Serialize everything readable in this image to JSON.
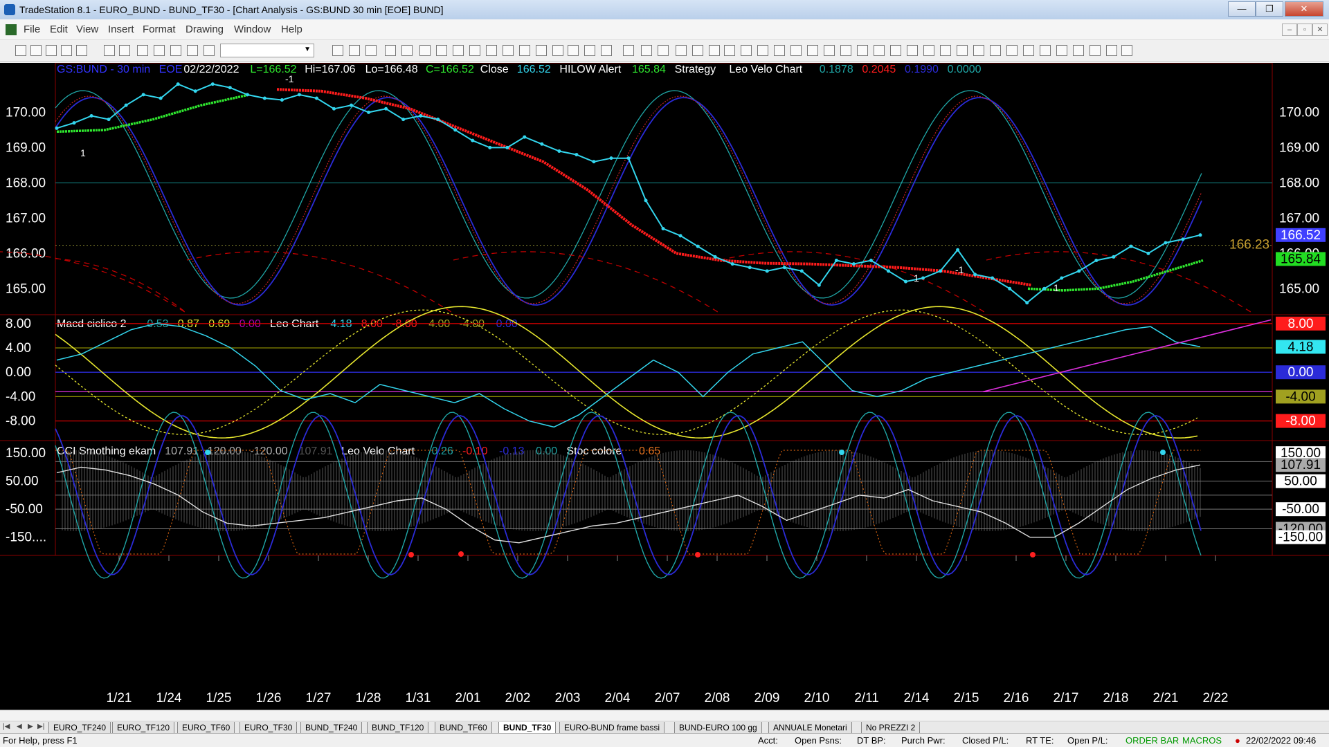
{
  "window": {
    "title": "TradeStation 8.1 - EURO_BUND - BUND_TF30 - [Chart Analysis - GS:BUND  30 min  [EOE] BUND]",
    "minimize": "—",
    "restore": "❐",
    "close": "✕"
  },
  "menu": {
    "items": [
      "File",
      "Edit",
      "View",
      "Insert",
      "Format",
      "Drawing",
      "Window",
      "Help"
    ],
    "mdi": [
      "–",
      "▫",
      "✕"
    ]
  },
  "colors": {
    "price": "#33d6ee",
    "red_avg": "#ff1c1c",
    "green_avg": "#2fe82f",
    "blue_osc": "#2b2bd8",
    "teal_osc": "#1fa6a6",
    "yellow": "#e6e62e",
    "magenta": "#e030e0",
    "grid_red": "#cc0000",
    "grid_teal": "#0f6f6f"
  },
  "header": {
    "price": [
      {
        "t": "GS:BUND - 30 min",
        "c": "#3333ff"
      },
      {
        "t": "EOE",
        "c": "#3333ff"
      },
      {
        "t": "02/22/2022",
        "c": "#ffffff"
      },
      {
        "t": "L=166.52",
        "c": "#2fe82f"
      },
      {
        "t": "Hi=167.06",
        "c": "#ffffff"
      },
      {
        "t": "Lo=166.48",
        "c": "#ffffff"
      },
      {
        "t": "C=166.52",
        "c": "#2fe82f"
      },
      {
        "t": "Close",
        "c": "#ffffff"
      },
      {
        "t": "166.52",
        "c": "#33d6ee"
      },
      {
        "t": "HILOW Alert",
        "c": "#ffffff"
      },
      {
        "t": "165.84",
        "c": "#2fe82f"
      },
      {
        "t": "Strategy",
        "c": "#ffffff"
      },
      {
        "t": "Leo Velo Chart",
        "c": "#ffffff"
      },
      {
        "t": "0.1878",
        "c": "#1fa6a6"
      },
      {
        "t": "0.2045",
        "c": "#ff1c1c"
      },
      {
        "t": "0.1990",
        "c": "#2b2bd8"
      },
      {
        "t": "0.0000",
        "c": "#1fa6a6"
      }
    ],
    "macd": [
      {
        "t": "Macd ciclico 2",
        "c": "#ffffff"
      },
      {
        "t": "0.53",
        "c": "#1fa6a6"
      },
      {
        "t": "0.87",
        "c": "#e6e62e"
      },
      {
        "t": "0.69",
        "c": "#e6e62e"
      },
      {
        "t": "0.00",
        "c": "#b000b0"
      },
      {
        "t": "Leo Chart",
        "c": "#ffffff"
      },
      {
        "t": "4.18",
        "c": "#33d6ee"
      },
      {
        "t": "8.00",
        "c": "#ff1c1c"
      },
      {
        "t": "-8.00",
        "c": "#ff1c1c"
      },
      {
        "t": "4.00",
        "c": "#a0a020"
      },
      {
        "t": "-4.00",
        "c": "#a0a020"
      },
      {
        "t": "0.00",
        "c": "#2b2bd8"
      }
    ],
    "cci": [
      {
        "t": "CCI Smothing ekam",
        "c": "#ffffff"
      },
      {
        "t": "107.91",
        "c": "#b0b0b0"
      },
      {
        "t": "120.00",
        "c": "#b0b0b0"
      },
      {
        "t": "-120.00",
        "c": "#b0b0b0"
      },
      {
        "t": "107.91",
        "c": "#555555"
      },
      {
        "t": "Leo Velo Chart",
        "c": "#ffffff"
      },
      {
        "t": "0.26",
        "c": "#1fa6a6"
      },
      {
        "t": "-0.10",
        "c": "#ff1c1c"
      },
      {
        "t": "-0.13",
        "c": "#2b2bd8"
      },
      {
        "t": "0.00",
        "c": "#1fa6a6"
      },
      {
        "t": "Stoc colore",
        "c": "#ffffff"
      },
      {
        "t": "0.65",
        "c": "#e07020"
      }
    ]
  },
  "chart_data": {
    "type": "line",
    "x_labels": [
      "1/21",
      "1/24",
      "1/25",
      "1/26",
      "1/27",
      "1/28",
      "1/31",
      "2/01",
      "2/02",
      "2/03",
      "2/04",
      "2/07",
      "2/08",
      "2/09",
      "2/10",
      "2/11",
      "2/14",
      "2/15",
      "2/16",
      "2/17",
      "2/18",
      "2/21",
      "2/22"
    ],
    "price_panel": {
      "y_ticks_left": [
        "170.00",
        "169.00",
        "168.00",
        "167.00",
        "166.00",
        "165.00"
      ],
      "y_ticks_right": [
        "170.00",
        "169.00",
        "168.00",
        "167.00",
        "166.00",
        "165.00"
      ],
      "ylim": [
        164.3,
        171.4
      ],
      "hline": 168.0,
      "last_value_line": 166.23,
      "last_value_label": "166.23",
      "right_badges": [
        {
          "text": "166.52",
          "value": 166.52,
          "bg": "#4040ff",
          "fg": "#ffffff"
        },
        {
          "text": "165.84",
          "value": 165.84,
          "bg": "#22dd22",
          "fg": "#000000"
        }
      ],
      "signal_labels": [
        "1",
        "-1",
        "1",
        "-1",
        "1"
      ],
      "close": [
        169.55,
        169.7,
        169.9,
        169.8,
        170.2,
        170.5,
        170.4,
        170.8,
        170.6,
        170.8,
        170.7,
        170.5,
        170.4,
        170.35,
        170.5,
        170.4,
        170.1,
        170.2,
        170.0,
        170.1,
        169.8,
        169.9,
        169.8,
        169.5,
        169.2,
        169.0,
        169.0,
        169.3,
        169.1,
        168.9,
        168.8,
        168.6,
        168.7,
        168.7,
        167.5,
        166.7,
        166.5,
        166.2,
        165.9,
        165.7,
        165.6,
        165.5,
        165.6,
        165.5,
        165.1,
        165.8,
        165.7,
        165.8,
        165.5,
        165.2,
        165.3,
        165.5,
        166.1,
        165.4,
        165.3,
        165.0,
        164.6,
        165.0,
        165.3,
        165.5,
        165.8,
        165.9,
        166.2,
        166.0,
        166.3,
        166.4,
        166.52
      ],
      "red_avg": [
        170.65,
        170.6,
        170.4,
        170.1,
        169.6,
        169.1,
        168.6,
        167.8,
        166.8,
        166.0,
        165.8,
        165.72,
        165.7,
        165.65,
        165.6,
        165.5,
        165.3,
        165.1
      ],
      "green_avg_left": [
        169.45,
        169.5,
        169.8,
        170.2,
        170.5
      ],
      "green_avg_right": [
        165.0,
        164.95,
        165.0,
        165.2,
        165.5,
        165.8
      ]
    },
    "macd_panel": {
      "y_ticks_left": [
        "8.00",
        "4.00",
        "0.00",
        "-4.00",
        "-8.00"
      ],
      "right_badges": [
        {
          "text": "8.00",
          "value": 8.0,
          "bg": "#ff1c1c",
          "fg": "#ffffff"
        },
        {
          "text": "4.18",
          "value": 4.18,
          "bg": "#33e6f0",
          "fg": "#000000"
        },
        {
          "text": "0.00",
          "value": 0.0,
          "bg": "#2b2bd8",
          "fg": "#ffffff"
        },
        {
          "text": "-4.00",
          "value": -4.0,
          "bg": "#a0a020",
          "fg": "#000000"
        },
        {
          "text": "-8.00",
          "value": -8.0,
          "bg": "#ff1c1c",
          "fg": "#ffffff"
        }
      ],
      "ylim": [
        -11,
        9
      ],
      "hlines": [
        8,
        4,
        0,
        -3.2,
        -4,
        -8
      ],
      "leo": [
        2,
        3,
        5,
        7,
        8,
        7.5,
        6,
        4,
        1,
        -3,
        -4.5,
        -3.5,
        -5,
        -2,
        -3,
        -4,
        -5,
        -3.5,
        -6,
        -8,
        -9,
        -7,
        -4,
        -1,
        2,
        0,
        -4,
        0,
        3,
        4,
        5,
        1,
        -3,
        -4,
        -3,
        -1,
        0,
        1,
        2,
        3,
        4,
        5,
        6,
        7,
        7.5,
        5,
        4.18
      ]
    },
    "cci_panel": {
      "y_ticks_left": [
        "150.00",
        "50.00",
        "-50.00",
        "-150...."
      ],
      "right_badges": [
        {
          "text": "150.00",
          "value": 150,
          "bg": "#ffffff",
          "fg": "#000000"
        },
        {
          "text": "107.91",
          "value": 107.91,
          "bg": "#aaaaaa",
          "fg": "#000000"
        },
        {
          "text": "50.00",
          "value": 50,
          "bg": "#ffffff",
          "fg": "#000000"
        },
        {
          "text": "-50.00",
          "value": -50,
          "bg": "#ffffff",
          "fg": "#000000"
        },
        {
          "text": "-120.00",
          "value": -120,
          "bg": "#aaaaaa",
          "fg": "#000000"
        },
        {
          "text": "-150.00",
          "value": -150,
          "bg": "#ffffff",
          "fg": "#000000"
        }
      ],
      "ylim": [
        -215,
        185
      ],
      "hlines": [
        120,
        50,
        0,
        -50,
        -120
      ],
      "cci_smooth": [
        80,
        100,
        90,
        70,
        40,
        0,
        -60,
        -100,
        -110,
        -100,
        -90,
        -80,
        -60,
        -40,
        -20,
        -10,
        -50,
        -110,
        -160,
        -170,
        -150,
        -130,
        -110,
        -100,
        -80,
        -60,
        -40,
        -20,
        0,
        -40,
        -90,
        -60,
        -30,
        0,
        -10,
        20,
        -20,
        -40,
        -60,
        -100,
        -150,
        -150,
        -100,
        -40,
        20,
        60,
        90,
        107.91
      ]
    }
  },
  "tabs": [
    "EURO_TF240",
    "EURO_TF120",
    "EURO_TF60",
    "EURO_TF30",
    "BUND_TF240",
    "BUND_TF120",
    "BUND_TF60",
    "BUND_TF30",
    "EURO-BUND frame bassi",
    "BUND-EURO 100 gg",
    "ANNUALE Monetari",
    "No PREZZI 2"
  ],
  "active_tab": "BUND_TF30",
  "status": {
    "help": "For Help, press F1",
    "acct": "Acct:",
    "open_psns": "Open Psns:",
    "dt_bp": "DT BP:",
    "purch_pwr": "Purch Pwr:",
    "closed_pl": "Closed P/L:",
    "rt_te": "RT TE:",
    "open_pl": "Open P/L:",
    "order_bar": "ORDER BAR",
    "macros": "MACROS",
    "datetime": "22/02/2022 09:46"
  }
}
